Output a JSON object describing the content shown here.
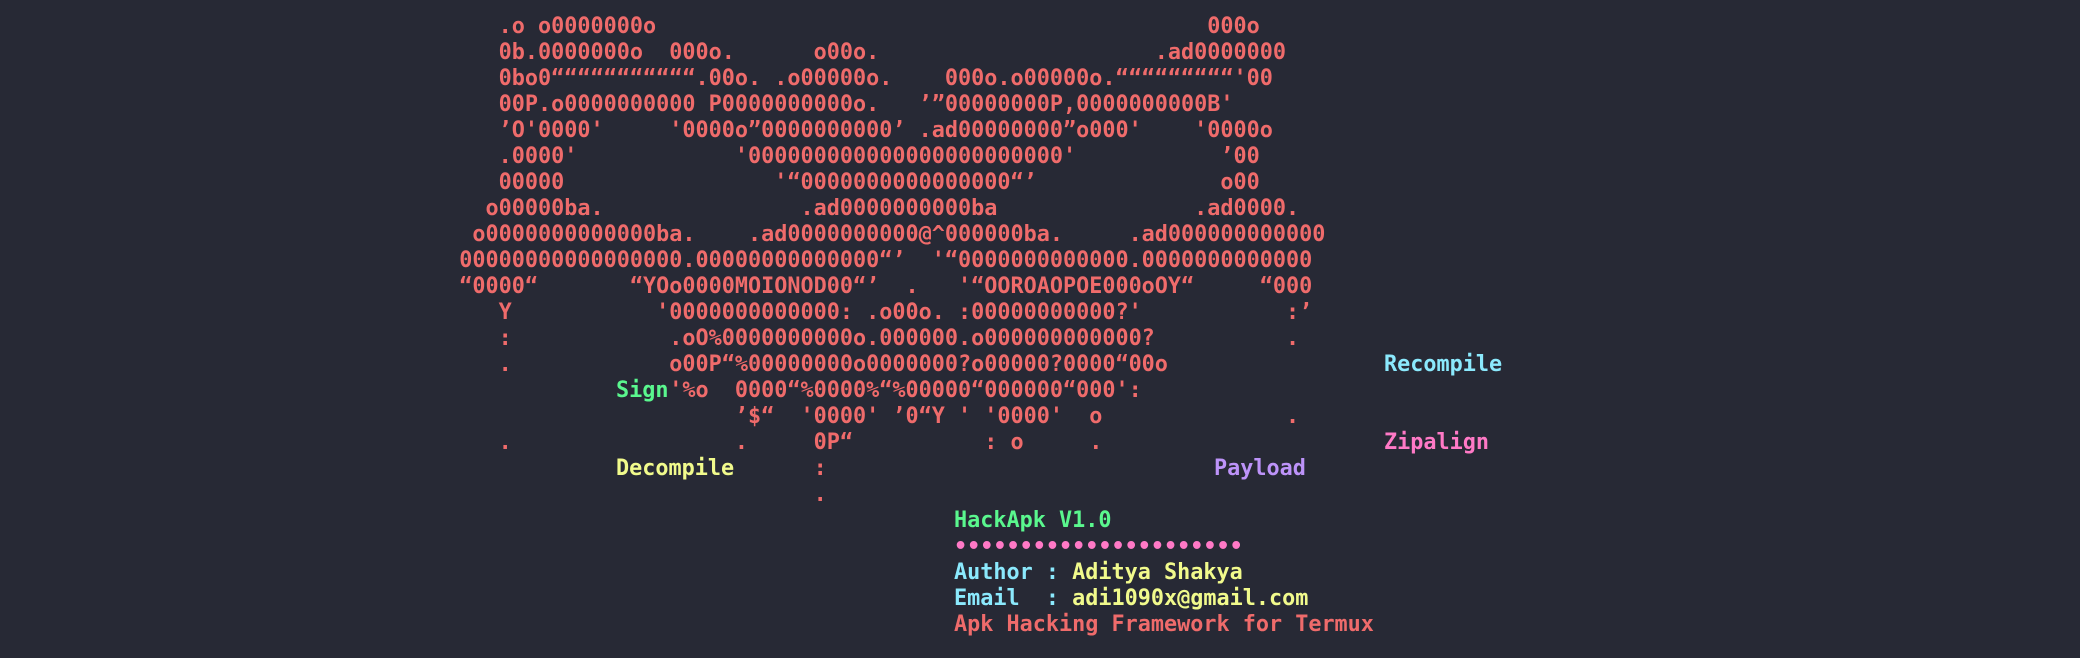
{
  "art": {
    "lines": [
      "                                      .o o0000000o                                          000o",
      "                                      0b.0000000o  000o.      o00o.                     .ad0000000",
      "                                      0bo0“““““““““““.00o. .o00000o.    000o.o00000o.“““““““““'00",
      "                                      00P.o0000000000 P0000000000o.   ’”00000000P,0000000000B'",
      "                                      ’O'0000'     '0000o”0000000000’ .ad00000000”o000'    '0000o",
      "                                      .0000'            '000000000000000000000000'           ’00",
      "                                      00000                '“0000000000000000“’              o00",
      "                                     o00000ba.               .ad0000000000ba               .ad0000.",
      "                                    o0000000000000ba.    .ad0000000000@^000000ba.     .ad000000000000",
      "                                   00000000000000000.00000000000000“’  '“0000000000000.0000000000000",
      "                                   “0000“       “YOo0000MOIONOD00“’  .   '“OOROAOPOE000oOY“     “000",
      "                                      Y           '0000000000000: .o00o. :00000000000?'           :’",
      "                                      :            .oO%0000000000o.000000.o000000000000?          .",
      "                                      .            o00P“%00000000o0000000?o00000?0000“00o",
      "                                                   '%o  0000“%0000%“%00000“000000“000':",
      "                                                        ’$“  '0000' ’0“Y ' '0000'  o              .",
      "                                      .                 .     0P“          : o     .",
      "                                                              :",
      "                                                              ."
    ]
  },
  "labels": {
    "sign": "Sign",
    "recompile": "Recompile",
    "zipalign": "Zipalign",
    "decompile": "Decompile",
    "payload": "Payload"
  },
  "info": {
    "title": "HackApk V1.0",
    "separator": "••••••••••••••••••••••",
    "author_key": "Author : ",
    "author_value": "Aditya Shakya",
    "email_key": "Email  : ",
    "email_value": "adi1090x@gmail.com",
    "tagline": "Apk Hacking Framework for Termux"
  },
  "colors": {
    "background": "#272935",
    "art": "#ef6b6b",
    "green": "#5af78e",
    "cyan": "#8be9fd",
    "yellow": "#f1fa8c",
    "pink": "#ff79c6",
    "purple": "#bd93f9"
  }
}
